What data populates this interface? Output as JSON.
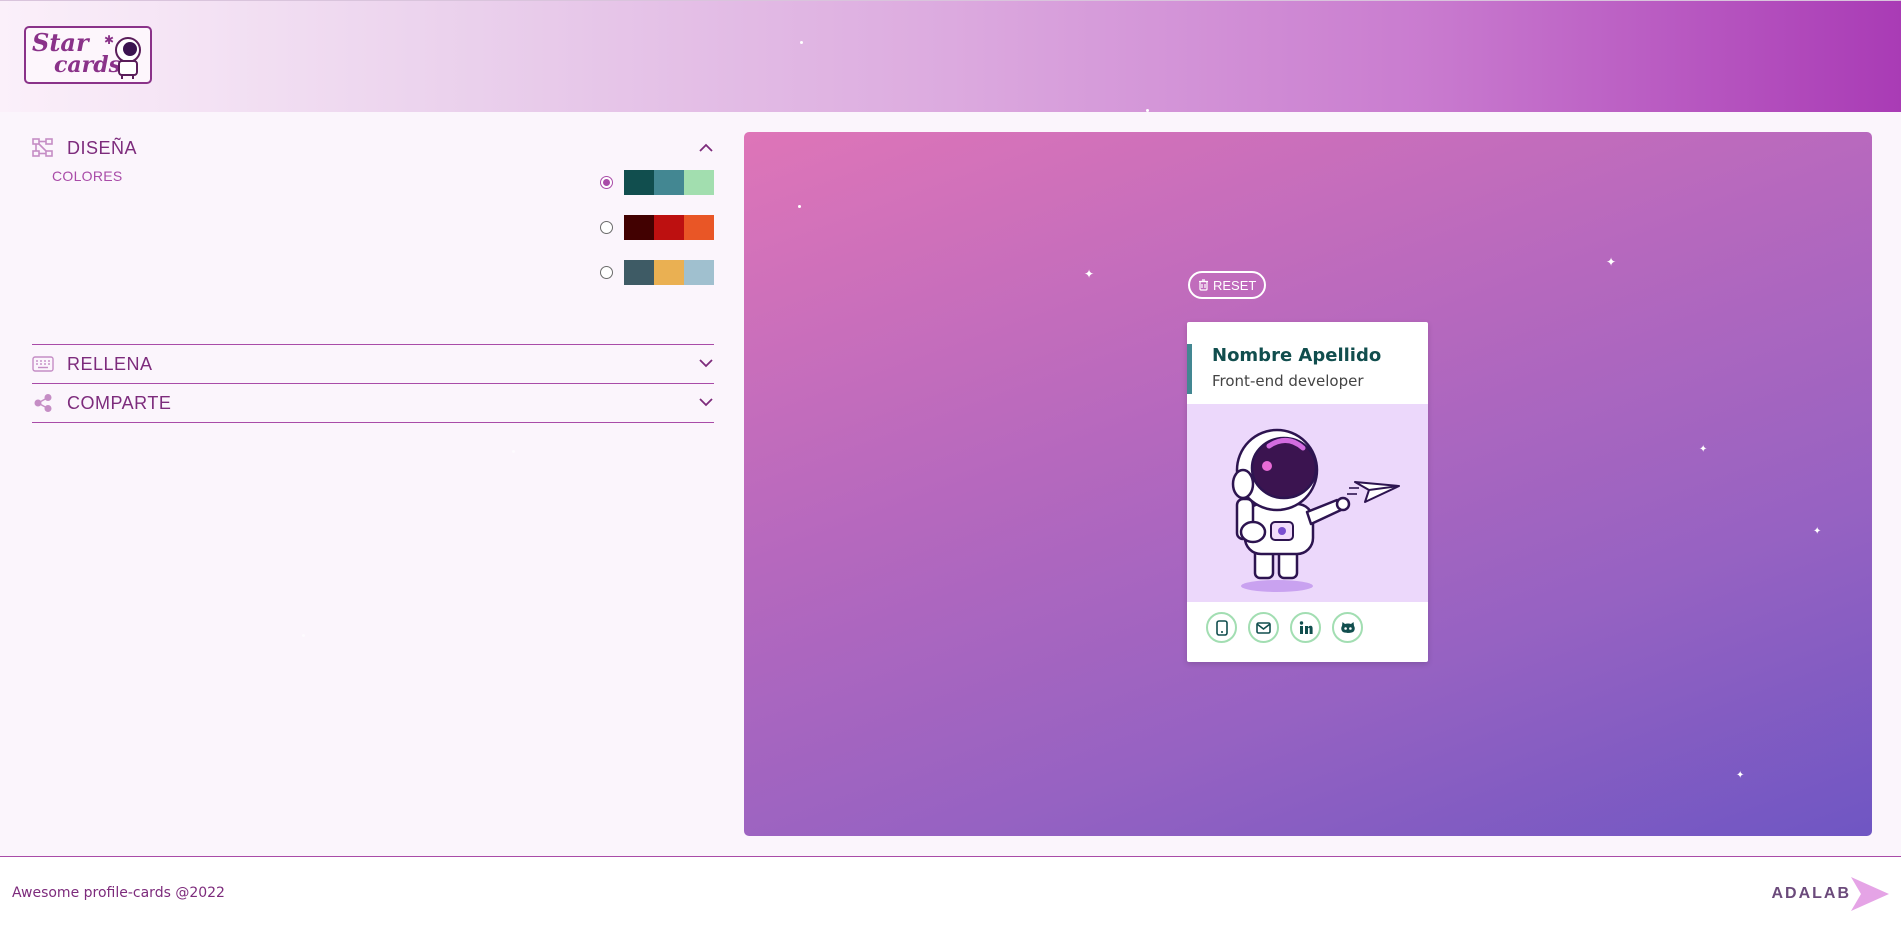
{
  "header": {
    "logo_alt": "Star cards",
    "logo_line1": "Star",
    "logo_line2": "cards"
  },
  "design": {
    "title": "DISEÑA",
    "colors_label": "COLORES",
    "palettes": [
      {
        "checked": true,
        "colors": [
          "#114e4e",
          "#438792",
          "#a2deaf"
        ]
      },
      {
        "checked": false,
        "colors": [
          "#420101",
          "#bd1010",
          "#e95626"
        ]
      },
      {
        "checked": false,
        "colors": [
          "#3e5b65",
          "#eab052",
          "#a0c0cf"
        ]
      }
    ]
  },
  "fill": {
    "title": "RELLENA"
  },
  "share": {
    "title": "COMPARTE"
  },
  "preview": {
    "reset_label": "RESET",
    "card": {
      "name": "Nombre Apellido",
      "job": "Front-end developer",
      "social_icons": [
        "phone-icon",
        "mail-icon",
        "linkedin-icon",
        "github-icon"
      ]
    }
  },
  "footer": {
    "copyright": "Awesome profile-cards @2022",
    "brand": "ADALAB"
  },
  "colors": {
    "primary": "#7d2b7c",
    "accent": "#a94ba8",
    "card_dark": "#114e4e",
    "card_mid": "#438792",
    "card_light": "#a2deaf"
  }
}
